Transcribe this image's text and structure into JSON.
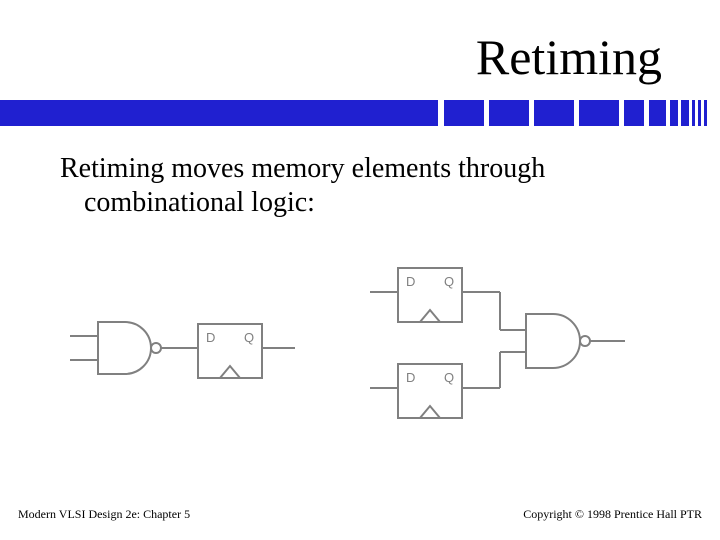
{
  "title": "Retiming",
  "body_line1": "Retiming moves memory elements through",
  "body_line2": "combinational logic:",
  "diagram": {
    "ff_d_label": "D",
    "ff_q_label": "Q"
  },
  "footer_left": "Modern VLSI Design 2e: Chapter 5",
  "footer_right": "Copyright © 1998 Prentice Hall PTR"
}
